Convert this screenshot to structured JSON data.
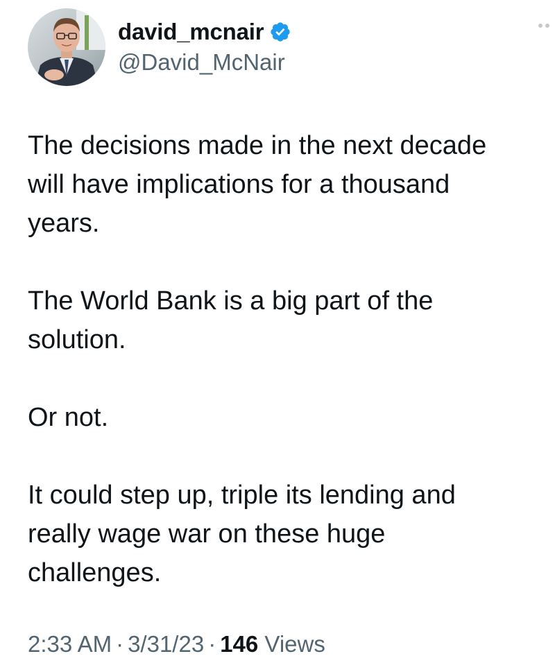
{
  "author": {
    "display_name": "david_mcnair",
    "handle": "@David_McNair",
    "verified": true,
    "verified_color": "#1d9bf0"
  },
  "tweet": {
    "paragraphs": [
      "The decisions made in the next decade\nwill have implications for a thousand\nyears.",
      "The World Bank is a big part of the\nsolution.",
      "Or not.",
      "It could step up, triple its lending and\nreally wage war on these huge\nchallenges."
    ]
  },
  "meta": {
    "time": "2:33 AM",
    "separator": "·",
    "date": "3/31/23",
    "views_count": "146",
    "views_label": "Views"
  },
  "icons": {
    "verified": "verified-badge-icon",
    "more": "more-options-icon"
  }
}
